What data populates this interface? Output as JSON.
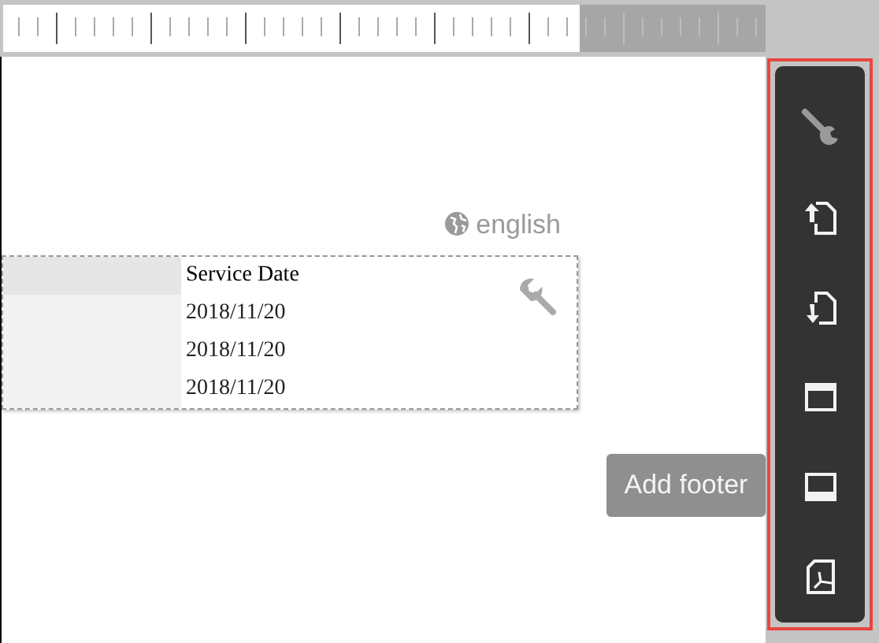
{
  "language": {
    "label": "english"
  },
  "table": {
    "columns": [
      "Service Date"
    ],
    "rows": [
      [
        "2018/11/20"
      ],
      [
        "2018/11/20"
      ],
      [
        "2018/11/20"
      ]
    ]
  },
  "add_footer_button": {
    "label": "Add footer",
    "disabled": true
  },
  "toolbar": [
    {
      "kind": "wrench",
      "disabled": true
    },
    {
      "kind": "upload"
    },
    {
      "kind": "download"
    },
    {
      "kind": "header"
    },
    {
      "kind": "footer"
    },
    {
      "kind": "pdf"
    }
  ]
}
